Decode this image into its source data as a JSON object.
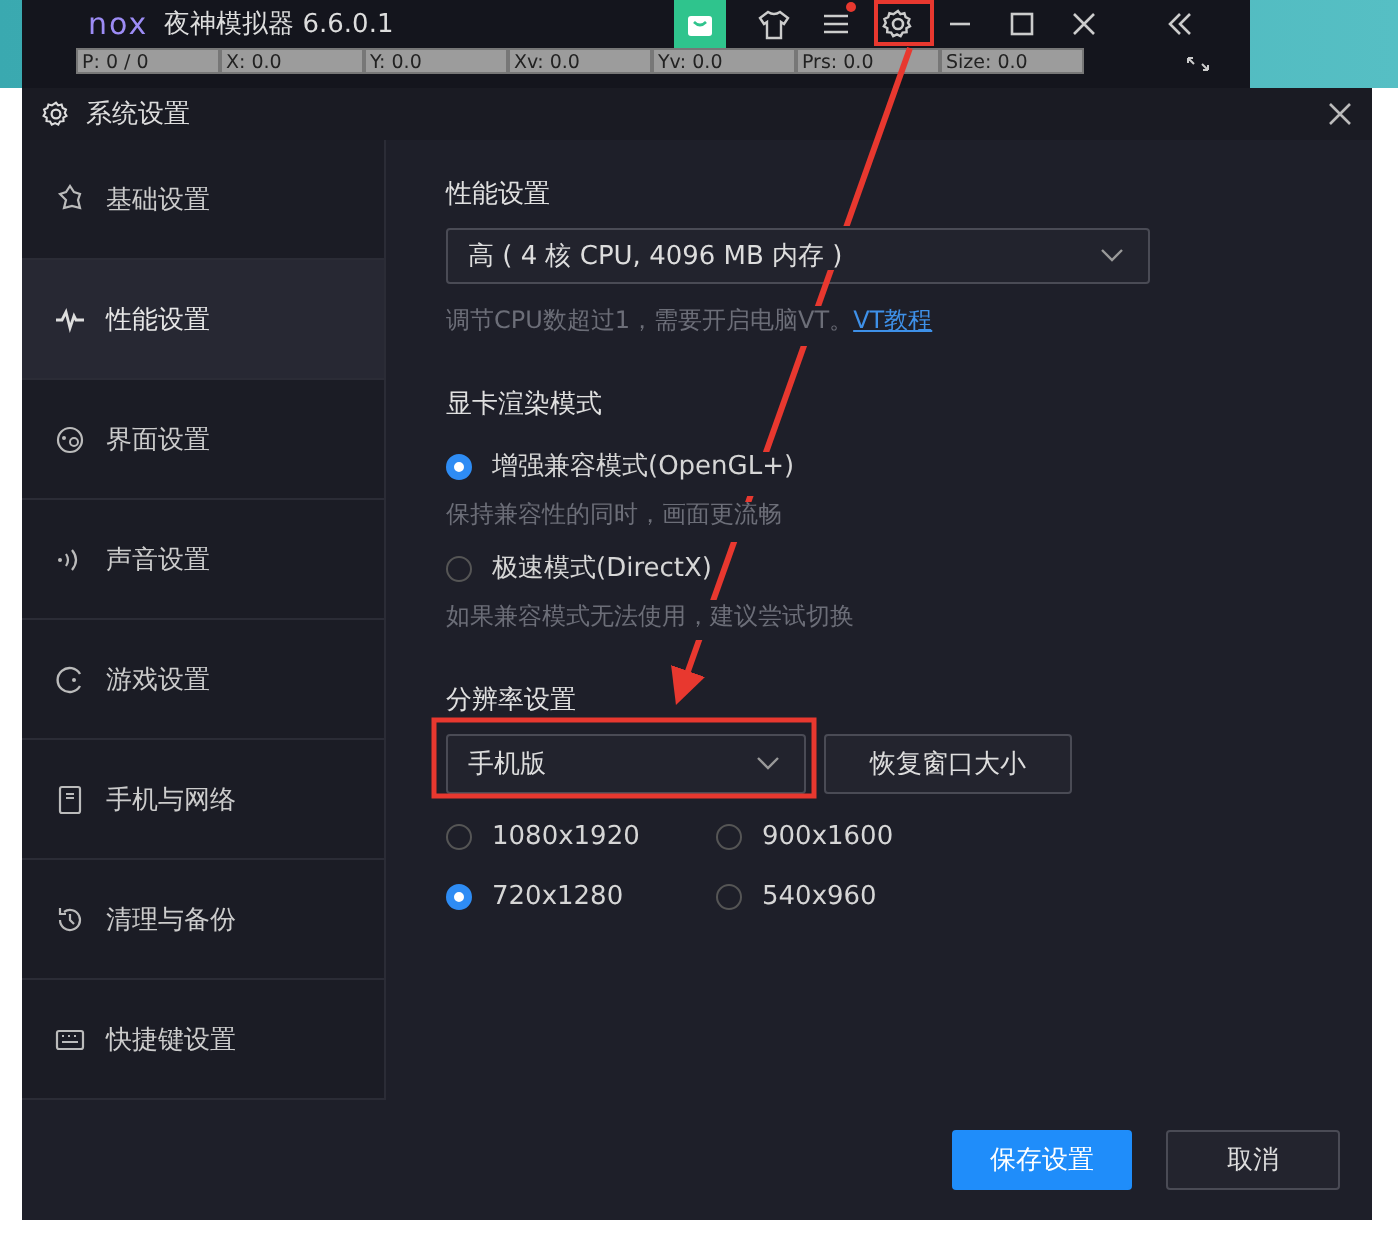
{
  "emulator_bar": {
    "logo": "nox",
    "title": "夜神模拟器 6.6.0.1",
    "debug_fields": [
      "P: 0 / 0",
      "X: 0.0",
      "Y: 0.0",
      "Xv: 0.0",
      "Yv: 0.0",
      "Prs: 0.0",
      "Size: 0.0"
    ],
    "menu_notification": true
  },
  "dialog": {
    "title": "系统设置"
  },
  "sidebar": {
    "items": [
      {
        "label": "基础设置",
        "selected": false
      },
      {
        "label": "性能设置",
        "selected": true
      },
      {
        "label": "界面设置",
        "selected": false
      },
      {
        "label": "声音设置",
        "selected": false
      },
      {
        "label": "游戏设置",
        "selected": false
      },
      {
        "label": "手机与网络",
        "selected": false
      },
      {
        "label": "清理与备份",
        "selected": false
      },
      {
        "label": "快捷键设置",
        "selected": false
      }
    ]
  },
  "performance": {
    "heading": "性能设置",
    "select_value": "高 ( 4 核 CPU, 4096 MB 内存 )",
    "hint": "调节CPU数超过1，需要开启电脑VT。",
    "hint_link": "VT教程"
  },
  "render": {
    "heading": "显卡渲染模式",
    "options": [
      {
        "label": "增强兼容模式(OpenGL+)",
        "selected": true,
        "hint": "保持兼容性的同时，画面更流畅"
      },
      {
        "label": "极速模式(DirectX)",
        "selected": false,
        "hint": "如果兼容模式无法使用，建议尝试切换"
      }
    ]
  },
  "resolution": {
    "heading": "分辨率设置",
    "select_value": "手机版",
    "reset_button": "恢复窗口大小",
    "options": [
      {
        "label": "1080x1920",
        "selected": false
      },
      {
        "label": "900x1600",
        "selected": false
      },
      {
        "label": "720x1280",
        "selected": true
      },
      {
        "label": "540x960",
        "selected": false
      }
    ]
  },
  "buttons": {
    "save": "保存设置",
    "cancel": "取消"
  }
}
